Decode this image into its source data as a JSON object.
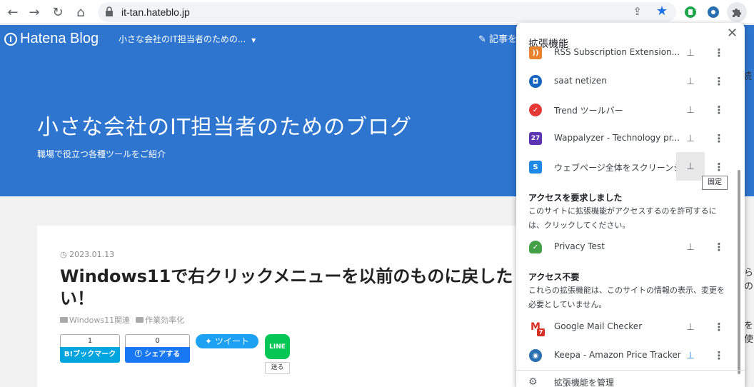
{
  "browser": {
    "url": "it-tan.hateblo.jp",
    "icons": [
      "back-arrow-icon",
      "forward-arrow-icon",
      "reload-icon",
      "home-icon",
      "lock-icon",
      "share-icon",
      "star-icon",
      "extension-puzzle-icon"
    ]
  },
  "blog": {
    "logo_text": "Hatena Blog",
    "selector": "小さな会社のIT担当者のための...",
    "edit_link": "記事を",
    "title": "小さな会社のIT担当者のためのブログ",
    "description": "職場で役立つ各種ツールをご紹介",
    "header_color": "#2e75d0"
  },
  "post": {
    "date": "2023.01.13",
    "title": "Windows11で右クリックメニューを以前のものに戻したい！",
    "categories": [
      "Windows11関連",
      "作業効率化"
    ],
    "share": {
      "hatena_count": "1",
      "hatena_label": "B!ブックマーク",
      "facebook_count": "0",
      "facebook_label": "シェアする",
      "tweet_label": "ツイート",
      "line_label": "LINE",
      "line_send": "送る"
    }
  },
  "sidebar_fragments": [
    "らの",
    "を使",
    "読"
  ],
  "extensions": {
    "title": "拡張機能",
    "tooltip": "固定",
    "full_access": [
      {
        "name": "RSS Subscription Extension...",
        "icon": "rss-icon",
        "color": "#e8822e",
        "pinned": false
      },
      {
        "name": "saat netizen",
        "icon": "lock-badge-icon",
        "color": "#1565c0",
        "pinned": false
      },
      {
        "name": "Trend ツールバー",
        "icon": "trend-icon",
        "color": "#e53935",
        "pinned": false
      },
      {
        "name": "Wappalyzer - Technology pr...",
        "icon": "wappalyzer-icon",
        "color": "#5e35b1",
        "badge": "27",
        "pinned": false
      },
      {
        "name": "ウェブページ全体をスクリーンショ...",
        "icon": "screenshot-icon",
        "color": "#1e88e5",
        "pinned": false
      }
    ],
    "request_section": {
      "heading": "アクセスを要求しました",
      "description": "このサイトに拡張機能がアクセスするのを許可するには、クリックしてください。",
      "items": [
        {
          "name": "Privacy Test",
          "icon": "shield-check-icon",
          "color": "#43a047",
          "pinned": false
        }
      ]
    },
    "no_access_section": {
      "heading": "アクセス不要",
      "description": "これらの拡張機能は、このサイトの情報の表示、変更を必要としていません。",
      "items": [
        {
          "name": "Google Mail Checker",
          "icon": "gmail-icon",
          "color": "#d93025",
          "badge": "7",
          "pinned": false
        },
        {
          "name": "Keepa - Amazon Price Tracker",
          "icon": "keepa-icon",
          "color": "#2a6fb0",
          "pinned": true
        }
      ]
    },
    "manage_label": "拡張機能を管理"
  }
}
